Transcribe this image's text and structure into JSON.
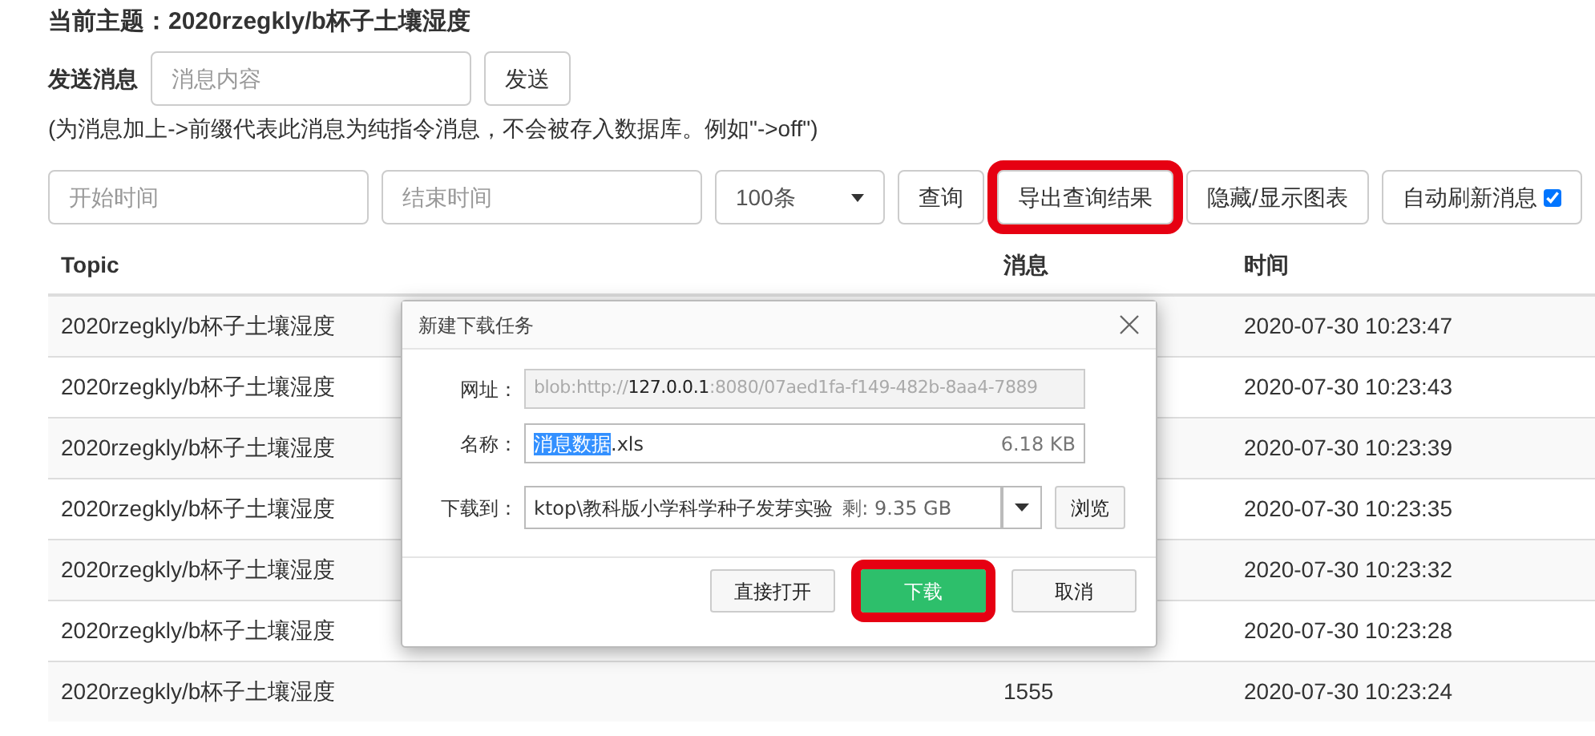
{
  "topic_title": "当前主题：2020rzegkly/b杯子土壤湿度",
  "send": {
    "label": "发送消息",
    "placeholder": "消息内容",
    "button": "发送"
  },
  "hint": "(为消息加上->前缀代表此消息为纯指令消息，不会被存入数据库。例如\"->off\")",
  "filters": {
    "start_placeholder": "开始时间",
    "end_placeholder": "结束时间",
    "limit": "100条",
    "buttons": [
      {
        "label": "查询",
        "highlighted": false
      },
      {
        "label": "导出查询结果",
        "highlighted": true
      },
      {
        "label": "隐藏/显示图表",
        "highlighted": false
      }
    ],
    "auto_refresh": {
      "label": "自动刷新消息",
      "checked": true
    }
  },
  "table": {
    "columns": [
      "Topic",
      "消息",
      "时间"
    ],
    "rows": [
      {
        "topic": "2020rzegkly/b杯子土壤湿度",
        "message": "",
        "time": "2020-07-30 10:23:47"
      },
      {
        "topic": "2020rzegkly/b杯子土壤湿度",
        "message": "",
        "time": "2020-07-30 10:23:43"
      },
      {
        "topic": "2020rzegkly/b杯子土壤湿度",
        "message": "",
        "time": "2020-07-30 10:23:39"
      },
      {
        "topic": "2020rzegkly/b杯子土壤湿度",
        "message": "",
        "time": "2020-07-30 10:23:35"
      },
      {
        "topic": "2020rzegkly/b杯子土壤湿度",
        "message": "",
        "time": "2020-07-30 10:23:32"
      },
      {
        "topic": "2020rzegkly/b杯子土壤湿度",
        "message": "",
        "time": "2020-07-30 10:23:28"
      },
      {
        "topic": "2020rzegkly/b杯子土壤湿度",
        "message": "1555",
        "time": "2020-07-30 10:23:24"
      }
    ]
  },
  "dialog": {
    "title": "新建下载任务",
    "url_label": "网址：",
    "url": "blob:http://**127.0.0.1**:8080/07aed1fa-f149-482b-8aa4-7889",
    "name_label": "名称：",
    "name": "*消息数据*.xls",
    "size": "6.18 KB",
    "path_label": "下载到：",
    "path": "ktop\\教科版小学科学种子发芽实验",
    "free": "剩: 9.35 GB",
    "browse": "浏览",
    "buttons": [
      {
        "label": "直接打开",
        "kind": "plain",
        "highlighted": false
      },
      {
        "label": "下载",
        "kind": "primary",
        "highlighted": true
      },
      {
        "label": "取消",
        "kind": "plain",
        "highlighted": false
      }
    ]
  }
}
